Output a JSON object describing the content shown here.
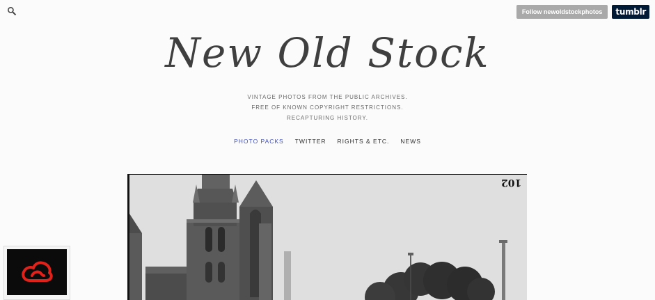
{
  "top_bar": {
    "search_icon": "search-icon",
    "follow_label": "Follow newoldstockphotos",
    "tumblr_label": "tumblr",
    "tumblr_color": "#001935",
    "follow_color": "#a9a9a9"
  },
  "header": {
    "title": "New Old Stock",
    "tagline": [
      "VINTAGE PHOTOS FROM THE PUBLIC ARCHIVES.",
      "FREE OF KNOWN COPYRIGHT RESTRICTIONS.",
      "RECAPTURING HISTORY."
    ]
  },
  "nav": [
    {
      "label": "PHOTO PACKS",
      "active": true
    },
    {
      "label": "TWITTER",
      "active": false
    },
    {
      "label": "RIGHTS & ETC.",
      "active": false
    },
    {
      "label": "NEWS",
      "active": false
    }
  ],
  "photo": {
    "number_label": "102"
  },
  "colors": {
    "nav_active": "#3f4fbf",
    "title_color": "#3f3f3f",
    "adobe_red": "#e0221b"
  },
  "ad": {
    "logo_icon": "adobe-creative-cloud-icon"
  }
}
